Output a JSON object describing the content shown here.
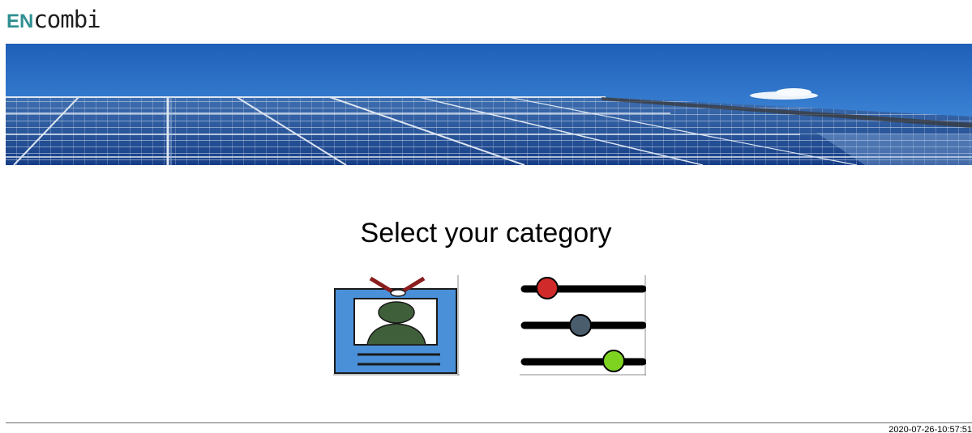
{
  "header": {
    "logo_prefix": "EN",
    "logo_suffix": "combi"
  },
  "main": {
    "heading": "Select your category",
    "categories": [
      {
        "icon": "user-badge-icon"
      },
      {
        "icon": "sliders-settings-icon"
      }
    ]
  },
  "footer": {
    "timestamp": "2020-07-26-10:57:51"
  },
  "colors": {
    "brand_teal": "#2f8f92",
    "logo_text": "#1e1e1e",
    "sky": "#2f73c9",
    "badge_blue": "#4a90d9",
    "figure_green": "#3f5f3a",
    "lanyard_red": "#8a1d1d",
    "slider_red": "#d02a2a",
    "slider_slate": "#4a5d6d",
    "slider_green": "#7ed321"
  }
}
